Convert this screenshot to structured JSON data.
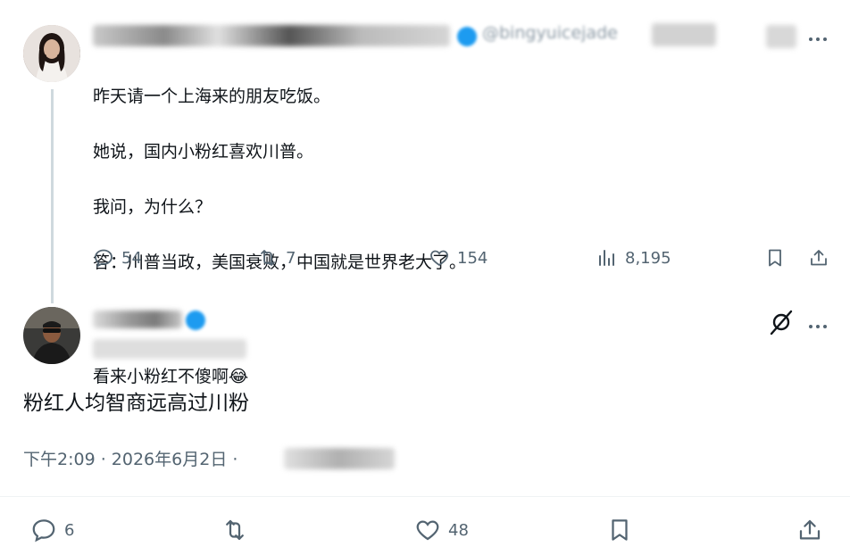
{
  "parent_tweet": {
    "handle_fragment": "@bingyuicejade",
    "lines": [
      "昨天请一个上海来的朋友吃饭。",
      "她说，国内小粉红喜欢川普。",
      "我问，为什么？",
      "答：川普当政，美国衰败，中国就是世界老大了。",
      "",
      "看来小粉红不傻啊😂"
    ],
    "stats": {
      "replies": "54",
      "reposts": "7",
      "likes": "154",
      "views": "8,195"
    }
  },
  "reply_tweet": {
    "text": "粉红人均智商远高过川粉",
    "timestamp": "下午2:09 · 2026年6月2日 ·",
    "stats": {
      "replies": "6",
      "likes": "48"
    }
  },
  "colors": {
    "text": "#0f1419",
    "secondary": "#536471",
    "verified": "#1d9bf0",
    "line": "#cfd9de"
  }
}
